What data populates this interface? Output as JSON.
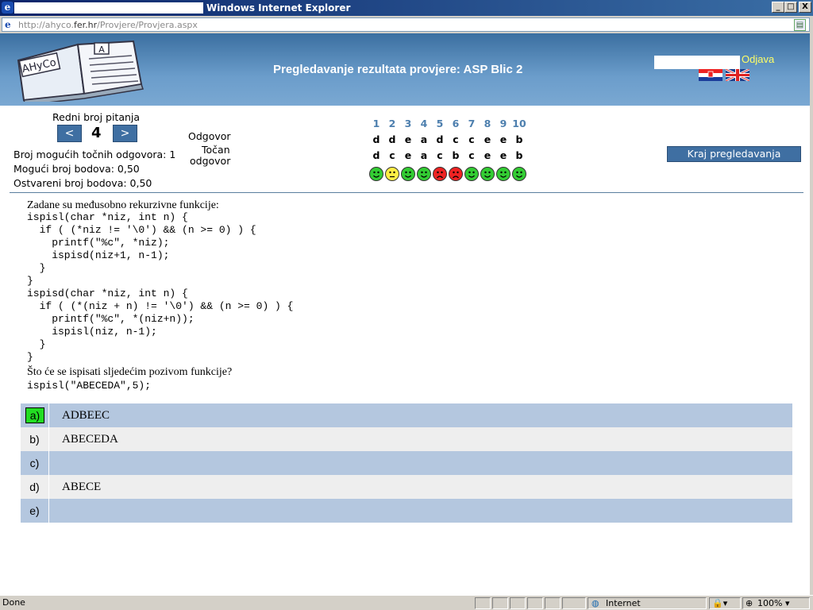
{
  "window": {
    "title": "Windows Internet Explorer",
    "url_prefix": "http://ahyco.",
    "url_domain": "fer.hr",
    "url_path": "/Provjere/Provjera.aspx",
    "buttons": {
      "minimize": "_",
      "maximize": "□",
      "close": "X"
    }
  },
  "header": {
    "title": "Pregledavanje rezultata provjere: ASP Blic 2",
    "logout": "Odjava",
    "logo_text": "AHyCo",
    "logo_badge": "A"
  },
  "nav": {
    "question_label": "Redni broj pitanja",
    "prev": "<",
    "next": ">",
    "current": "4",
    "answer_label": "Odgovor",
    "correct_label_1": "Točan",
    "correct_label_2": "odgovor",
    "possible_correct": "Broj mogućih točnih odgovora: 1",
    "possible_points": "Mogući broj bodova: 0,50",
    "achieved_points": "Ostvareni broj bodova: 0,50",
    "end_button": "Kraj pregledavanja"
  },
  "results": {
    "numbers": [
      "1",
      "2",
      "3",
      "4",
      "5",
      "6",
      "7",
      "8",
      "9",
      "10"
    ],
    "answers": [
      "d",
      "d",
      "e",
      "a",
      "d",
      "c",
      "c",
      "e",
      "e",
      "b"
    ],
    "correct": [
      "d",
      "c",
      "e",
      "a",
      "c",
      "b",
      "c",
      "e",
      "e",
      "b"
    ],
    "status": [
      "correct",
      "partial",
      "correct",
      "correct",
      "wrong",
      "wrong",
      "correct",
      "correct",
      "correct",
      "correct"
    ],
    "colors": {
      "correct": "#33cc33",
      "partial": "#ffee44",
      "wrong": "#ee2222"
    }
  },
  "question": {
    "intro": "Zadane su međusobno rekurzivne funkcije:",
    "code1": [
      "ispisl(char *niz, int n) {",
      "  if ( (*niz != '\\0') && (n >= 0) ) {",
      "    printf(\"%c\", *niz);",
      "    ispisd(niz+1, n-1);",
      "  }",
      "}",
      "ispisd(char *niz, int n) {",
      "  if ( (*(niz + n) != '\\0') && (n >= 0) ) {",
      "    printf(\"%c\", *(niz+n));",
      "    ispisl(niz, n-1);",
      "  }",
      "}"
    ],
    "prompt": "Što će se ispisati sljedećim pozivom funkcije?",
    "call": "ispisl(\"ABECEDA\",5);"
  },
  "answers": [
    {
      "letter": "a)",
      "text": "ADBEEC",
      "selected": true
    },
    {
      "letter": "b)",
      "text": "ABECEDA",
      "selected": false
    },
    {
      "letter": "c)",
      "text": "",
      "selected": false
    },
    {
      "letter": "d)",
      "text": "ABECE",
      "selected": false
    },
    {
      "letter": "e)",
      "text": "",
      "selected": false
    }
  ],
  "status": {
    "left": "Done",
    "zone": "Internet",
    "zoom": "100%"
  }
}
